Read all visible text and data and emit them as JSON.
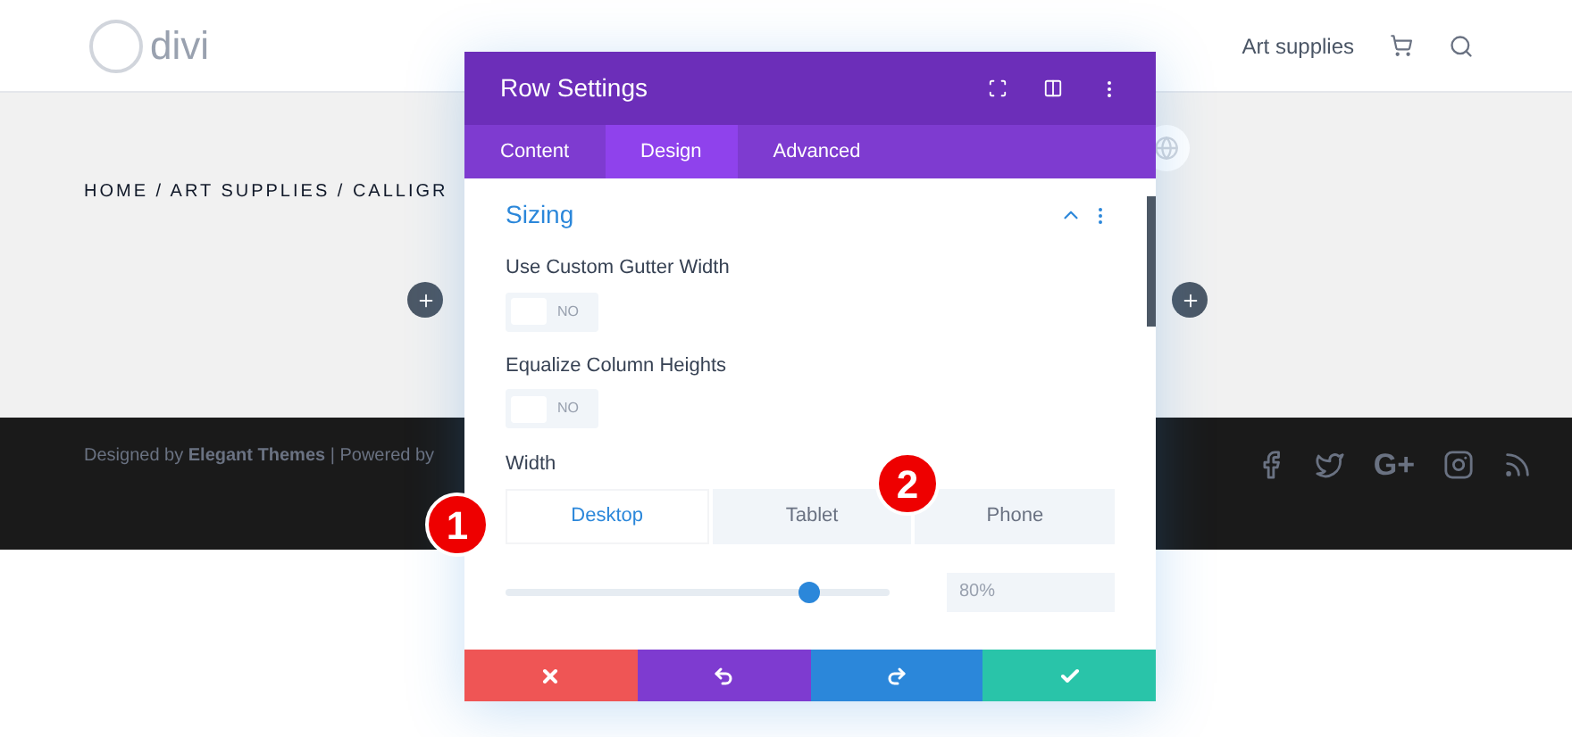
{
  "site": {
    "logo": "divi",
    "nav": [
      {
        "label": "Art supplies"
      }
    ],
    "breadcrumb": "HOME / ART SUPPLIES / CALLIGR",
    "footer_text": "Designed by **Elegant Themes** | Powered by",
    "social_text": "G+"
  },
  "modal": {
    "title": "Row Settings",
    "tabs": [
      {
        "label": "Content",
        "selected": false
      },
      {
        "label": "Design",
        "selected": true
      },
      {
        "label": "Advanced",
        "selected": false
      }
    ],
    "section": {
      "title": "Sizing",
      "expanded": true
    },
    "fields": [
      {
        "kind": "toggle",
        "label": "Use Custom Gutter Width",
        "on": false,
        "state_label": "NO"
      },
      {
        "kind": "toggle",
        "label": "Equalize Column Heights",
        "on": false,
        "state_label": "NO"
      },
      {
        "kind": "slider",
        "label": "Width",
        "devices": [
          {
            "label": "Desktop",
            "selected": true
          },
          {
            "label": "Tablet",
            "selected": false
          },
          {
            "label": "Phone",
            "selected": false
          }
        ],
        "level": 0.79,
        "value": "80%"
      }
    ]
  },
  "markers": [
    "1",
    "2"
  ]
}
